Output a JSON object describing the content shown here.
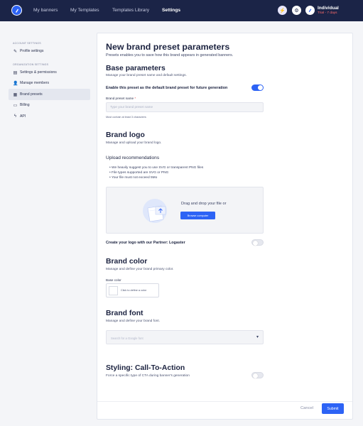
{
  "topbar": {
    "nav": [
      "My banners",
      "My Templates",
      "Templates Library",
      "Settings"
    ],
    "plan_name": "Individual",
    "plan_trial": "Trial - 7 days"
  },
  "sidebar": {
    "account_section": "ACCOUNT SETTINGS",
    "org_section": "ORGANIZATION SETTINGS",
    "items": [
      {
        "label": "Profile settings",
        "icon": "pencil-icon"
      },
      {
        "label": "Settings & permissions",
        "icon": "settings-icon"
      },
      {
        "label": "Manage members",
        "icon": "user-plus-icon"
      },
      {
        "label": "Brand presets",
        "icon": "brand-icon"
      },
      {
        "label": "Billing",
        "icon": "card-icon"
      },
      {
        "label": "API",
        "icon": "bolt-icon"
      }
    ]
  },
  "form": {
    "title": "New brand preset parameters",
    "subtitle": "Presets enables you to save how this brand appears in generated banners.",
    "base": {
      "title": "Base parameters",
      "desc": "Manage your brand preset name and default settings.",
      "default_toggle_label": "Enable this preset as the default brand preset for future generation",
      "name_label": "Brand preset name",
      "name_required": "*",
      "name_placeholder": "Type your brand preset name",
      "name_hint": "Must contain at least 3 characters"
    },
    "logo": {
      "title": "Brand logo",
      "desc": "Manage and upload your brand logo.",
      "reco_title": "Upload recommendations",
      "reco": [
        "We heavily suggest you to use SVG or transparent PNG files",
        "File types supported are SVG or PNG",
        "Your file must not exceed 5Mo"
      ],
      "drop_text": "Drag and drop your file or",
      "browse_label": "Browse computer",
      "partner_label": "Create your logo with our Partner: Logaster"
    },
    "color": {
      "title": "Brand color",
      "desc": "Manage and define your brand primary color.",
      "base_label": "Base color",
      "define_text": "Click to define a color"
    },
    "font": {
      "title": "Brand font",
      "desc": "Manage and define your brand font.",
      "placeholder": "Search for a Google font"
    },
    "cta": {
      "title": "Styling: Call-To-Action",
      "desc": "Force a specific type of CTA during banner's generation"
    },
    "cancel_label": "Cancel",
    "submit_label": "Submit"
  },
  "colors": {
    "topbar": "#1b2447",
    "accent": "#2d63f5",
    "trial": "#ff6b6b"
  }
}
